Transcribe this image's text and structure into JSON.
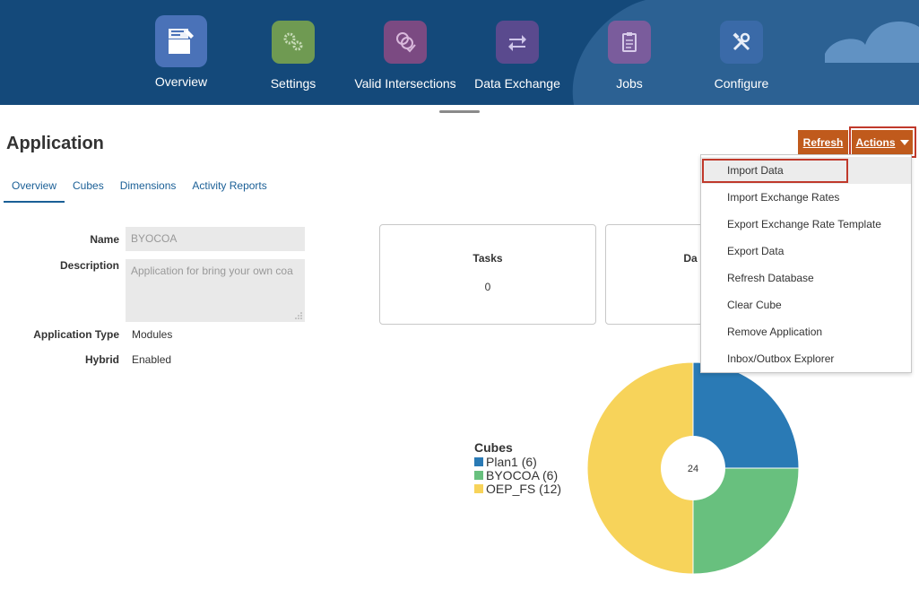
{
  "nav": {
    "items": [
      {
        "label": "Overview",
        "icon": "overview-icon",
        "color": "#4a72b8"
      },
      {
        "label": "Settings",
        "icon": "gears-icon",
        "color": "#6f9a52"
      },
      {
        "label": "Valid Intersections",
        "icon": "intersections-icon",
        "color": "#7b4a82"
      },
      {
        "label": "Data Exchange",
        "icon": "exchange-icon",
        "color": "#5a4a8e"
      },
      {
        "label": "Jobs",
        "icon": "clipboard-icon",
        "color": "#7a5c9c"
      },
      {
        "label": "Configure",
        "icon": "tools-icon",
        "color": "#3a6aa8"
      }
    ]
  },
  "page": {
    "title": "Application",
    "refresh_label": "Refresh",
    "actions_label": "Actions"
  },
  "tabs": [
    "Overview",
    "Cubes",
    "Dimensions",
    "Activity Reports"
  ],
  "form": {
    "name_label": "Name",
    "name_value": "BYOCOA",
    "description_label": "Description",
    "description_value": "Application for bring your own coa",
    "app_type_label": "Application Type",
    "app_type_value": "Modules",
    "hybrid_label": "Hybrid",
    "hybrid_value": "Enabled"
  },
  "cards": [
    {
      "title": "Tasks",
      "value": "0"
    },
    {
      "title": "Da",
      "value": ""
    }
  ],
  "menu": {
    "items": [
      "Import Data",
      "Import Exchange Rates",
      "Export Exchange Rate Template",
      "Export Data",
      "Refresh Database",
      "Clear Cube",
      "Remove Application",
      "Inbox/Outbox Explorer"
    ]
  },
  "chart_data": {
    "type": "pie",
    "title": "Cubes",
    "center_label": "24",
    "series": [
      {
        "name": "Plan1 (6)",
        "value": 6,
        "color": "#2a7ab5"
      },
      {
        "name": "BYOCOA (6)",
        "value": 6,
        "color": "#68c07e"
      },
      {
        "name": "OEP_FS (12)",
        "value": 12,
        "color": "#f7d35a"
      }
    ]
  },
  "colors": {
    "header": "#14497a",
    "accent_button": "#c05a1c",
    "link": "#1a5f96"
  }
}
